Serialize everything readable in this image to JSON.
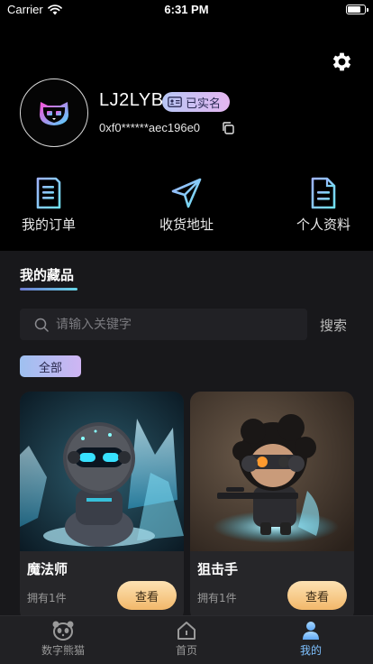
{
  "status_bar": {
    "carrier": "Carrier",
    "time": "6:31 PM",
    "battery_level": 0.7
  },
  "profile": {
    "username": "LJ2LYB",
    "verified_label": "已实名",
    "verified_icon": "id-card-icon",
    "wallet_address": "0xf0******aec196e0"
  },
  "quick_actions": [
    {
      "label": "我的订单",
      "icon": "order-document-icon"
    },
    {
      "label": "收货地址",
      "icon": "location-arrow-icon"
    },
    {
      "label": "个人资料",
      "icon": "profile-document-icon"
    }
  ],
  "collection": {
    "title": "我的藏品",
    "search_placeholder": "请输入关键字",
    "search_button": "搜索",
    "filter_all": "全部",
    "items": [
      {
        "name": "魔法师",
        "owned": "拥有1件",
        "action": "查看"
      },
      {
        "name": "狙击手",
        "owned": "拥有1件",
        "action": "查看"
      }
    ]
  },
  "tabbar": {
    "items": [
      {
        "label": "数字熊猫",
        "icon": "panda-icon",
        "active": false
      },
      {
        "label": "首页",
        "icon": "home-icon",
        "active": false
      },
      {
        "label": "我的",
        "icon": "user-icon",
        "active": true
      }
    ]
  },
  "colors": {
    "accent_blue": "#7fc1ff",
    "button_gold": "#f2b86a",
    "panel_bg": "#18181b"
  }
}
